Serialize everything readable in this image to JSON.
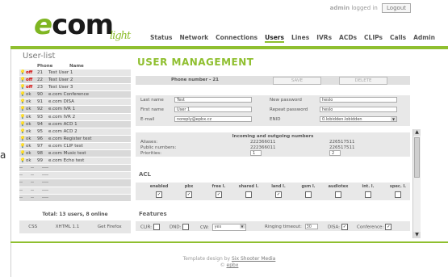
{
  "header": {
    "logo_prefix": "e",
    "logo_main": "com",
    "logo_suffix": "light",
    "user_name": "admin",
    "user_status": "logged in",
    "logout_label": "Logout"
  },
  "nav": [
    "Status",
    "Network",
    "Connections",
    "Users",
    "Lines",
    "IVRs",
    "ACDs",
    "CLIPs",
    "Calls",
    "Admin"
  ],
  "nav_active": "Users",
  "sidebar": {
    "title": "User-list",
    "col_phone": "Phone",
    "col_name": "Name",
    "rows": [
      {
        "status": "off",
        "phone": "21",
        "name": "Test User 1"
      },
      {
        "status": "off",
        "phone": "22",
        "name": "Test User 2"
      },
      {
        "status": "off",
        "phone": "23",
        "name": "Test User 3"
      },
      {
        "status": "ok",
        "phone": "90",
        "name": "e.com Conference"
      },
      {
        "status": "ok",
        "phone": "91",
        "name": "e.com DISA"
      },
      {
        "status": "ok",
        "phone": "92",
        "name": "e.com IVR 1"
      },
      {
        "status": "ok",
        "phone": "93",
        "name": "e.com IVR 2"
      },
      {
        "status": "ok",
        "phone": "94",
        "name": "e.com ACD 1"
      },
      {
        "status": "ok",
        "phone": "95",
        "name": "e.com ACD 2"
      },
      {
        "status": "ok",
        "phone": "96",
        "name": "e.com Register test"
      },
      {
        "status": "ok",
        "phone": "97",
        "name": "e.com CLIP test"
      },
      {
        "status": "ok",
        "phone": "98",
        "name": "e.com Music test"
      },
      {
        "status": "ok",
        "phone": "99",
        "name": "e.com Echo test"
      },
      {
        "status": "--",
        "phone": "--",
        "name": "----"
      },
      {
        "status": "--",
        "phone": "--",
        "name": "----"
      },
      {
        "status": "--",
        "phone": "--",
        "name": "----"
      },
      {
        "status": "--",
        "phone": "--",
        "name": "----"
      },
      {
        "status": "--",
        "phone": "--",
        "name": "----"
      }
    ],
    "total": "Total: 13 users, 8 online",
    "footer_links": [
      "CSS",
      "XHTML 1.1",
      "Get Firefox"
    ]
  },
  "main": {
    "title": "USER MANAGEMENT",
    "phone_label": "Phone number - 21",
    "save_label": "SAVE",
    "delete_label": "DELETE",
    "form": {
      "last_name_label": "Last name",
      "last_name_value": "Test",
      "first_name_label": "First name",
      "first_name_value": "User 1",
      "email_label": "E-mail",
      "email_value": "noreply@epbx.cz",
      "new_password_label": "New password",
      "new_password_value": "heslo",
      "repeat_password_label": "Repeat password",
      "repeat_password_value": "heslo",
      "enid_label": "ENID",
      "enid_value": "0.lobidden.lobidden"
    },
    "numbers": {
      "heading": "Incoming and outgoing numbers",
      "aliases_label": "Aliases:",
      "aliases_in": "222366011",
      "aliases_out": "226517511",
      "public_label": "Public numbers:",
      "public_in": "222366011",
      "public_out": "226517511",
      "priorities_label": "Priorities:",
      "priority_in": "1",
      "priority_out": "2"
    },
    "acl": {
      "title": "ACL",
      "columns": [
        {
          "label": "enabled",
          "checked": true
        },
        {
          "label": "pbx",
          "checked": true
        },
        {
          "label": "free l.",
          "checked": true
        },
        {
          "label": "shared l.",
          "checked": false
        },
        {
          "label": "land l.",
          "checked": true
        },
        {
          "label": "gsm l.",
          "checked": false
        },
        {
          "label": "audiotex",
          "checked": false
        },
        {
          "label": "int. l.",
          "checked": false
        },
        {
          "label": "spec. l.",
          "checked": false
        }
      ]
    },
    "features": {
      "title": "Features",
      "clir_label": "CLIR:",
      "clir_checked": false,
      "dnd_label": "DND:",
      "dnd_checked": false,
      "cw_label": "CW:",
      "cw_value": "yes",
      "ringing_label": "Ringing timeout:",
      "ringing_value": "30",
      "disa_label": "DISA:",
      "disa_checked": true,
      "conference_label": "Conference:",
      "conference_checked": true
    }
  },
  "footer": {
    "design_text": "Template design by",
    "design_link": "Six Shooter Media",
    "copyright": "©",
    "copyright_link": "epbx"
  },
  "colors": {
    "accent": "#8fbf2f",
    "off": "#d40000"
  }
}
